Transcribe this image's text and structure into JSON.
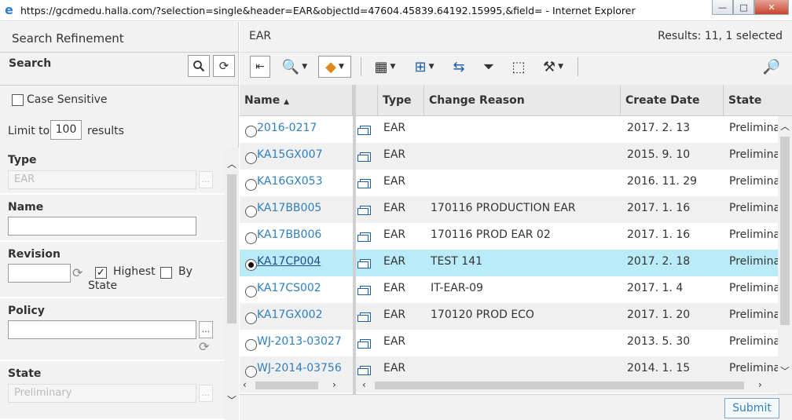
{
  "window": {
    "title": "https://gcdmedu.halla.com/?selection=single&header=EAR&objectId=47604.45839.64192.15995,&field= - Internet Explorer",
    "btn_min": "—",
    "btn_max": "□",
    "btn_close": "✕"
  },
  "left": {
    "title": "Search Refinement",
    "search_label": "Search",
    "case_sensitive": "Case Sensitive",
    "limit_prefix": "Limit to",
    "limit_value": "100",
    "limit_suffix": "results",
    "sections": {
      "type": {
        "title": "Type",
        "value": "EAR"
      },
      "name": {
        "title": "Name",
        "value": ""
      },
      "revision": {
        "title": "Revision",
        "value": "",
        "highest": "Highest",
        "by": "By",
        "state": "State"
      },
      "policy": {
        "title": "Policy",
        "value": ""
      },
      "state": {
        "title": "State",
        "value": "Preliminary"
      }
    }
  },
  "right": {
    "header": "EAR",
    "results": "Results: 11, 1 selected",
    "columns": [
      "Name",
      "",
      "Type",
      "Change Reason",
      "Create Date",
      "State"
    ],
    "sort_indicator": "▲",
    "rows": [
      {
        "name": "2016-0217",
        "type": "EAR",
        "reason": "",
        "date": "2017. 2. 13",
        "state": "Preliminary"
      },
      {
        "name": "KA15GX007",
        "type": "EAR",
        "reason": "",
        "date": "2015. 9. 10",
        "state": "Preliminary"
      },
      {
        "name": "KA16GX053",
        "type": "EAR",
        "reason": "",
        "date": "2016. 11. 29",
        "state": "Preliminary"
      },
      {
        "name": "KA17BB005",
        "type": "EAR",
        "reason": "170116 PRODUCTION EAR",
        "date": "2017. 1. 16",
        "state": "Preliminary"
      },
      {
        "name": "KA17BB006",
        "type": "EAR",
        "reason": "170116 PROD EAR 02",
        "date": "2017. 1. 16",
        "state": "Preliminary"
      },
      {
        "name": "KA17CP004",
        "type": "EAR",
        "reason": "TEST 141",
        "date": "2017. 2. 18",
        "state": "Preliminary"
      },
      {
        "name": "KA17CS002",
        "type": "EAR",
        "reason": "IT-EAR-09",
        "date": "2017. 1. 4",
        "state": "Preliminary"
      },
      {
        "name": "KA17GX002",
        "type": "EAR",
        "reason": "170120 PROD ECO",
        "date": "2017. 1. 20",
        "state": "Preliminary"
      },
      {
        "name": "WJ-2013-03027",
        "type": "EAR",
        "reason": "",
        "date": "2013. 5. 30",
        "state": "Preliminary"
      },
      {
        "name": "WJ-2014-03756",
        "type": "EAR",
        "reason": "",
        "date": "2014. 1. 15",
        "state": "Preliminary"
      }
    ],
    "selected_index": 5,
    "submit": "Submit"
  }
}
